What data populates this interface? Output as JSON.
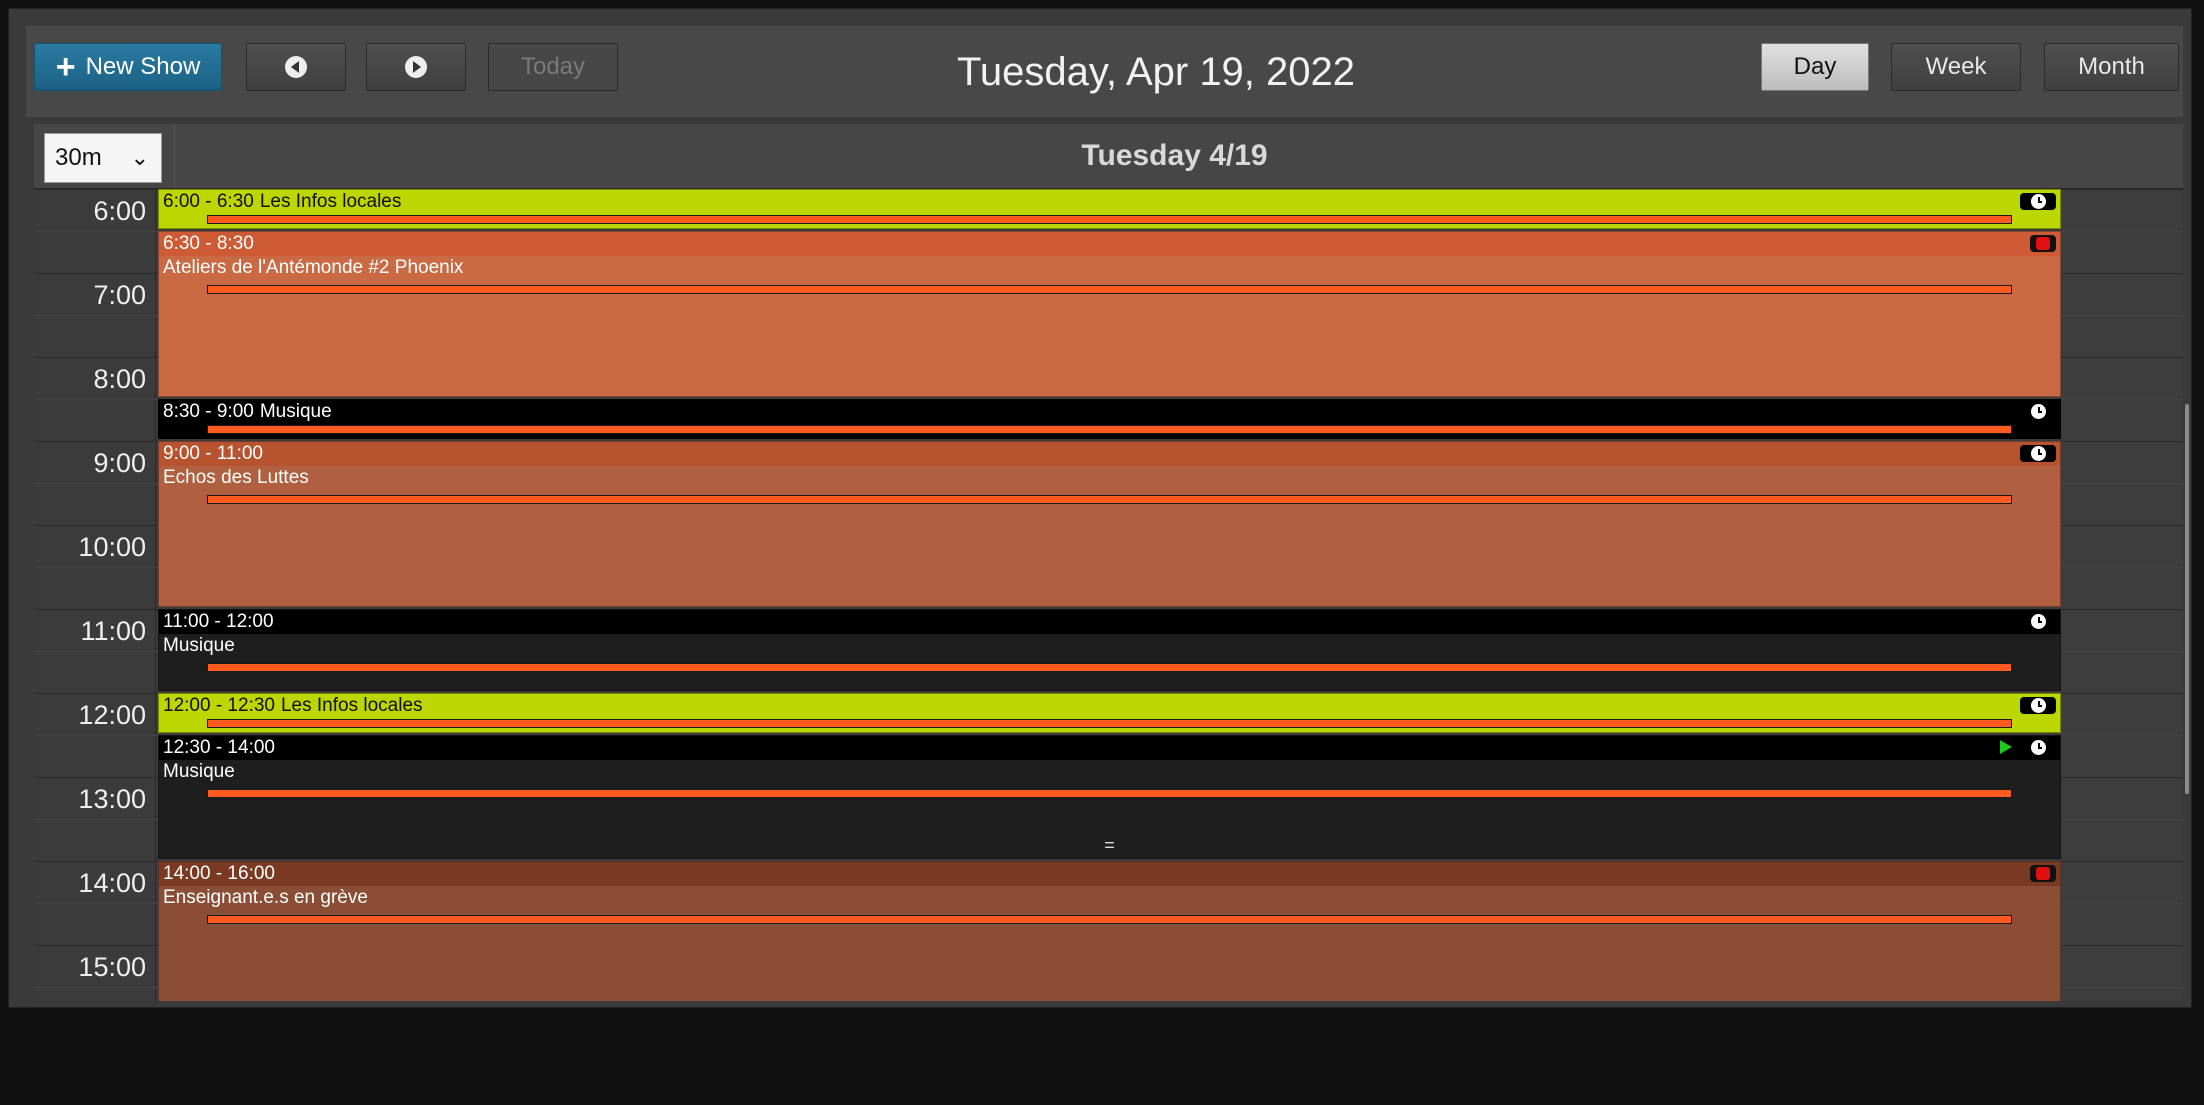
{
  "toolbar": {
    "new_show_label": "New Show",
    "today_label": "Today",
    "date_title": "Tuesday, Apr 19, 2022",
    "views": {
      "day": "Day",
      "week": "Week",
      "month": "Month"
    },
    "active_view": "Day"
  },
  "column_header": {
    "interval": "30m",
    "day_heading": "Tuesday 4/19"
  },
  "hours": [
    "6:00",
    "7:00",
    "8:00",
    "9:00",
    "10:00",
    "11:00",
    "12:00",
    "13:00",
    "14:00",
    "15:00"
  ],
  "events": [
    {
      "time": "6:00 - 6:30",
      "title": "Les Infos locales",
      "inline": true,
      "color": "#bcd600",
      "header_color": "#bcd600",
      "text_color": "#111111",
      "icon": "clock"
    },
    {
      "time": "6:30 - 8:30",
      "title": "Ateliers de l'Antémonde #2 Phoenix",
      "inline": false,
      "color": "#c96a45",
      "header_color": "#cf5b35",
      "text_color": "#ffffff",
      "icon": "warning"
    },
    {
      "time": "8:30 - 9:00",
      "title": "Musique",
      "inline": true,
      "color": "#000000",
      "header_color": "#000000",
      "text_color": "#ffffff",
      "icon": "clock"
    },
    {
      "time": "9:00 - 11:00",
      "title": "Echos des Luttes",
      "inline": false,
      "color": "#b06040",
      "header_color": "#b8532f",
      "text_color": "#ffffff",
      "icon": "clock"
    },
    {
      "time": "11:00 - 12:00",
      "title": "Musique",
      "inline": false,
      "color": "#1e1e1e",
      "header_color": "#000000",
      "text_color": "#ffffff",
      "icon": "clock"
    },
    {
      "time": "12:00 - 12:30",
      "title": "Les Infos locales",
      "inline": true,
      "color": "#bcd600",
      "header_color": "#bcd600",
      "text_color": "#111111",
      "icon": "clock"
    },
    {
      "time": "12:30 - 14:00",
      "title": "Musique",
      "inline": false,
      "color": "#1e1e1e",
      "header_color": "#000000",
      "text_color": "#ffffff",
      "icon": "clock",
      "playing": true,
      "resize_handle": "="
    },
    {
      "time": "14:00 - 16:00",
      "title": "Enseignant.e.s en grève",
      "inline": false,
      "color": "#8a4e36",
      "header_color": "#7a3a22",
      "text_color": "#ffffff",
      "icon": "warning"
    }
  ]
}
